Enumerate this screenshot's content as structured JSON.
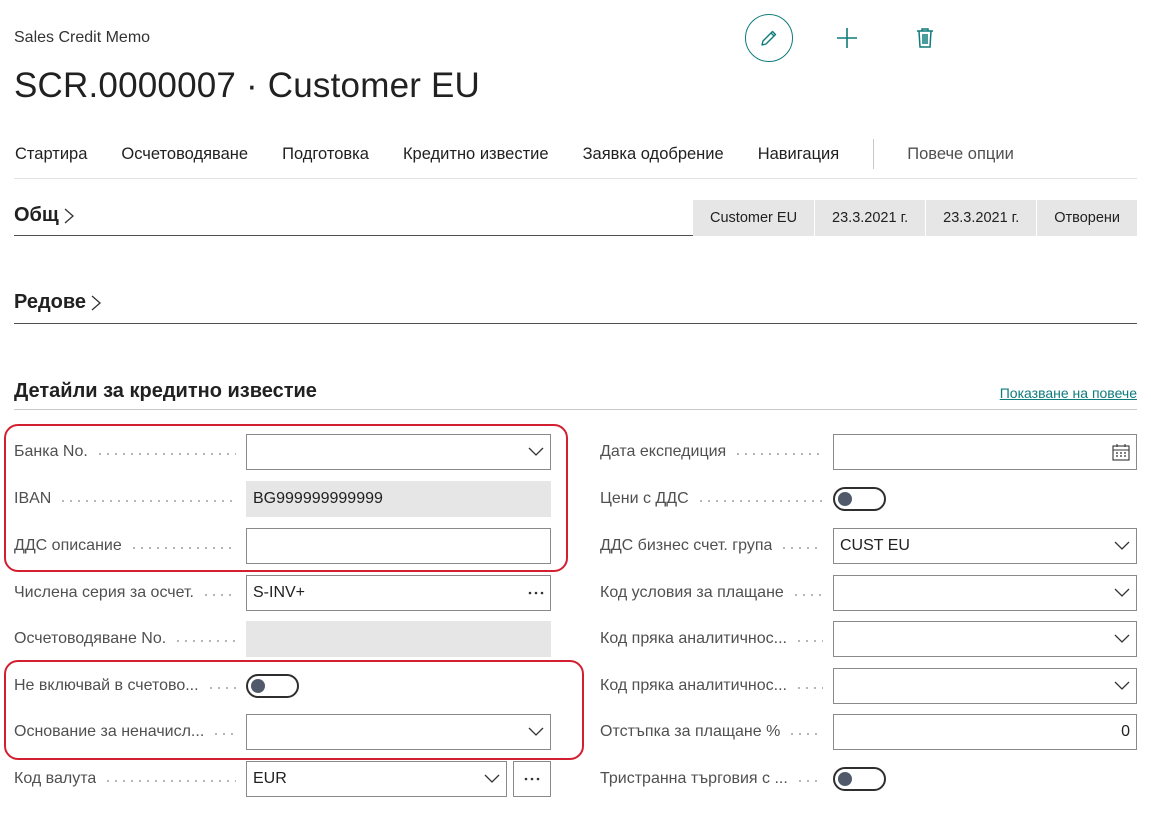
{
  "header": {
    "subtitle": "Sales Credit Memo",
    "title": "SCR.0000007 · Customer EU"
  },
  "actions": {
    "items": [
      "Стартира",
      "Осчетоводяване",
      "Подготовка",
      "Кредитно известие",
      "Заявка одобрение",
      "Навигация"
    ],
    "more": "Повече опции"
  },
  "sections": {
    "general": {
      "title": "Общ",
      "summary": [
        "Customer EU",
        "23.3.2021 г.",
        "23.3.2021 г.",
        "Отворени"
      ]
    },
    "lines": {
      "title": "Редове"
    },
    "details": {
      "title": "Детайли за кредитно известие",
      "show_more": "Показване на повече"
    }
  },
  "left_fields": [
    {
      "label": "Банка No.",
      "value": "",
      "type": "dropdown"
    },
    {
      "label": "IBAN",
      "value": "BG999999999999",
      "type": "readonly"
    },
    {
      "label": "ДДС описание",
      "value": "",
      "type": "text"
    },
    {
      "label": "Числена серия за осчет.",
      "value": "S-INV+",
      "type": "lookup"
    },
    {
      "label": "Осчетоводяване No.",
      "value": "",
      "type": "readonly"
    },
    {
      "label": "Не включвай в счетово...",
      "value": "off",
      "type": "toggle"
    },
    {
      "label": "Основание за неначисл...",
      "value": "",
      "type": "dropdown"
    },
    {
      "label": "Код валута",
      "value": "EUR",
      "type": "currency"
    }
  ],
  "right_fields": [
    {
      "label": "Дата експедиция",
      "value": "",
      "type": "date"
    },
    {
      "label": "Цени с ДДС",
      "value": "off",
      "type": "toggle"
    },
    {
      "label": "ДДС бизнес счет. група",
      "value": "CUST EU",
      "type": "dropdown"
    },
    {
      "label": "Код условия за плащане",
      "value": "",
      "type": "dropdown"
    },
    {
      "label": "Код пряка аналитичнос...",
      "value": "",
      "type": "dropdown"
    },
    {
      "label": "Код пряка аналитичнос...",
      "value": "",
      "type": "dropdown"
    },
    {
      "label": "Отстъпка за плащане %",
      "value": "0",
      "type": "number"
    },
    {
      "label": "Тристранна търговия с ...",
      "value": "off",
      "type": "toggle"
    }
  ],
  "colors": {
    "accent": "#0f7b7b",
    "highlight": "#d22030",
    "readonly_bg": "#e6e6e6"
  },
  "icons": {
    "edit": "pencil-icon",
    "new": "plus-icon",
    "delete": "trash-icon",
    "dropdown": "chevron-down-icon",
    "lookup": "ellipsis-icon",
    "date": "calendar-icon",
    "expand": "chevron-right-icon"
  }
}
